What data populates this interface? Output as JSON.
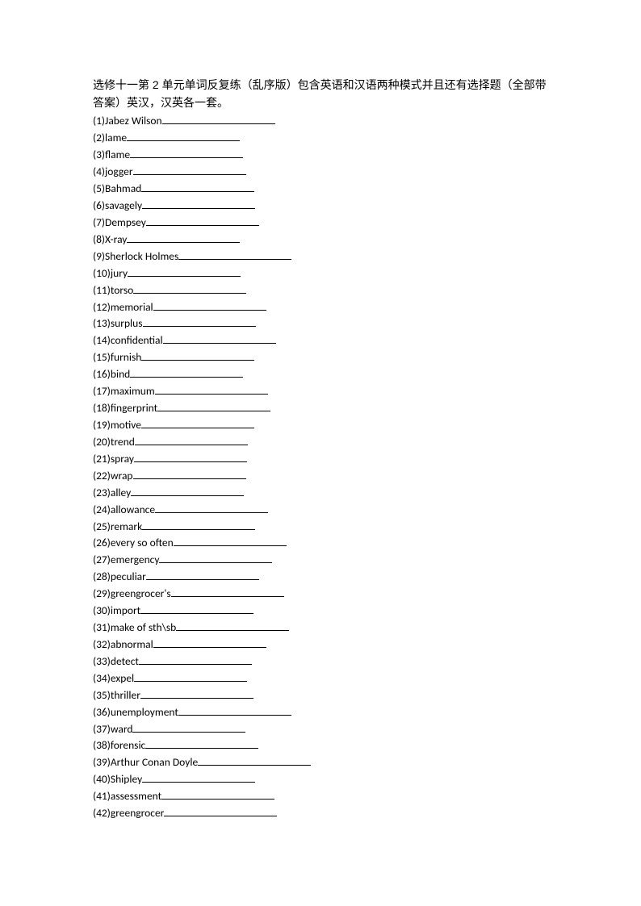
{
  "title": "选修十一第 2 单元单词反复练（乱序版）包含英语和汉语两种模式并且还有选择题（全部带答案）英汉，汉英各一套。",
  "items": [
    {
      "num": "(1)",
      "word": "Jabez Wilson"
    },
    {
      "num": "(2)",
      "word": "lame"
    },
    {
      "num": "(3)",
      "word": "flame"
    },
    {
      "num": "(4)",
      "word": "jogger"
    },
    {
      "num": "(5)",
      "word": "Bahmad"
    },
    {
      "num": "(6)",
      "word": "savagely"
    },
    {
      "num": "(7)",
      "word": "Dempsey"
    },
    {
      "num": "(8)",
      "word": "X-ray"
    },
    {
      "num": "(9)",
      "word": "Sherlock Holmes"
    },
    {
      "num": "(10)",
      "word": "jury"
    },
    {
      "num": "(11)",
      "word": "torso"
    },
    {
      "num": "(12)",
      "word": "memorial"
    },
    {
      "num": "(13)",
      "word": "surplus"
    },
    {
      "num": "(14)",
      "word": "confidential"
    },
    {
      "num": "(15)",
      "word": "furnish"
    },
    {
      "num": "(16)",
      "word": "bind"
    },
    {
      "num": "(17)",
      "word": "maximum"
    },
    {
      "num": "(18)",
      "word": "fingerprint"
    },
    {
      "num": "(19)",
      "word": "motive"
    },
    {
      "num": "(20)",
      "word": "trend"
    },
    {
      "num": "(21)",
      "word": "spray"
    },
    {
      "num": "(22)",
      "word": "wrap"
    },
    {
      "num": "(23)",
      "word": "alley"
    },
    {
      "num": "(24)",
      "word": "allowance"
    },
    {
      "num": "(25)",
      "word": "remark"
    },
    {
      "num": "(26)",
      "word": "every so often"
    },
    {
      "num": "(27)",
      "word": "emergency"
    },
    {
      "num": "(28)",
      "word": "peculiar"
    },
    {
      "num": "(29)",
      "word": "greengrocer's"
    },
    {
      "num": "(30)",
      "word": "import"
    },
    {
      "num": "(31)",
      "word": "make of sth\\sb"
    },
    {
      "num": "(32)",
      "word": "abnormal"
    },
    {
      "num": "(33)",
      "word": "detect"
    },
    {
      "num": "(34)",
      "word": "expel"
    },
    {
      "num": "(35)",
      "word": "thriller"
    },
    {
      "num": "(36)",
      "word": "unemployment"
    },
    {
      "num": "(37)",
      "word": "ward"
    },
    {
      "num": "(38)",
      "word": "forensic"
    },
    {
      "num": "(39)",
      "word": "Arthur Conan Doyle"
    },
    {
      "num": "(40)",
      "word": "Shipley"
    },
    {
      "num": "(41)",
      "word": "assessment"
    },
    {
      "num": "(42)",
      "word": "greengrocer"
    }
  ]
}
